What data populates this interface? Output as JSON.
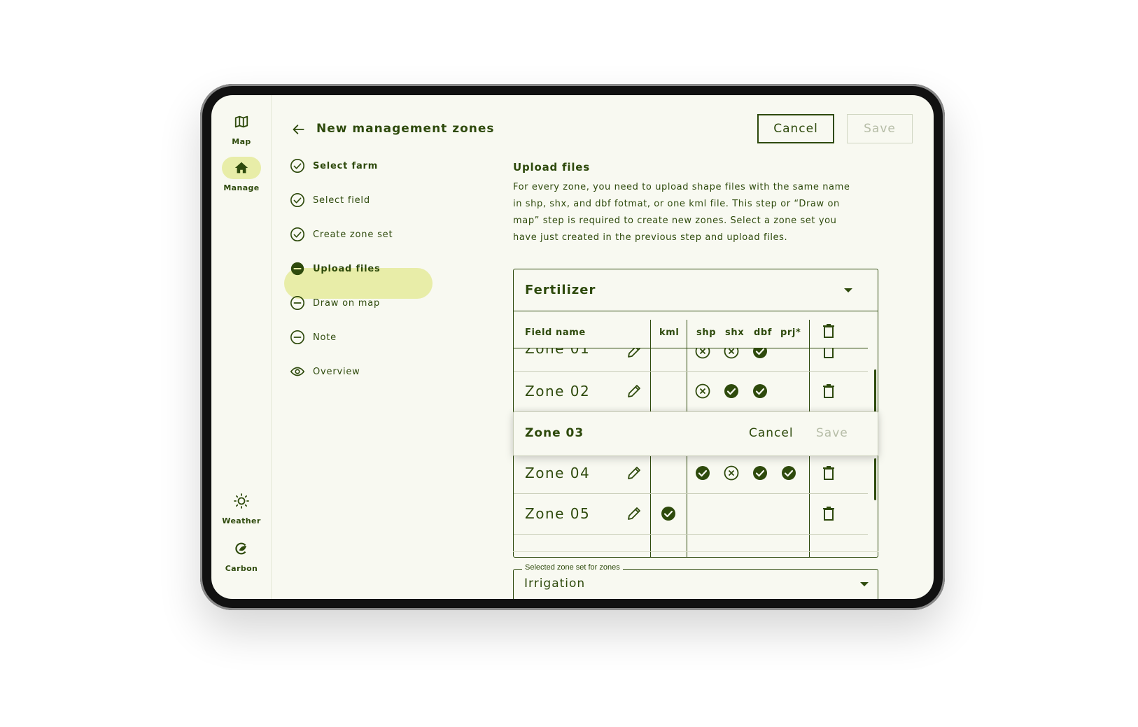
{
  "rail": {
    "items": [
      {
        "label": "Map",
        "icon": "map-icon"
      },
      {
        "label": "Manage",
        "icon": "home-icon",
        "active": true
      },
      {
        "label": "Weather",
        "icon": "sun-icon"
      },
      {
        "label": "Carbon",
        "icon": "carbon-icon"
      }
    ]
  },
  "header": {
    "title": "New management zones",
    "cancel_label": "Cancel",
    "save_label": "Save"
  },
  "steps": [
    {
      "label": "Select farm",
      "status": "done"
    },
    {
      "label": "Select field",
      "status": "done"
    },
    {
      "label": "Create zone set",
      "status": "done"
    },
    {
      "label": "Upload files",
      "status": "current"
    },
    {
      "label": "Draw on map",
      "status": "todo"
    },
    {
      "label": "Note",
      "status": "todo"
    },
    {
      "label": "Overview",
      "status": "view"
    }
  ],
  "upload": {
    "title": "Upload files",
    "description": "For every zone, you need to upload shape files with the same name in shp, shx, and dbf fotmat, or one kml file. This step or “Draw on map” step is required to create  new zones. Select a zone set you have just created in the previous step and upload files."
  },
  "zone_table": {
    "title": "Fertilizer",
    "columns": [
      "Field name",
      "kml",
      "shp",
      "shx",
      "dbf",
      "prj*"
    ],
    "rows": [
      {
        "name": "Zone 01",
        "kml": null,
        "shp": "missing",
        "shx": "missing",
        "dbf": "ok",
        "prj": null
      },
      {
        "name": "Zone 02",
        "kml": null,
        "shp": "missing",
        "shx": "ok",
        "dbf": "ok",
        "prj": null
      },
      {
        "name": "Zone 04",
        "kml": null,
        "shp": "ok",
        "shx": "missing",
        "dbf": "ok",
        "prj": "ok"
      },
      {
        "name": "Zone 05",
        "kml": "ok",
        "shp": null,
        "shx": null,
        "dbf": null,
        "prj": null
      }
    ],
    "editing_row": {
      "name": "Zone 03",
      "cancel_label": "Cancel",
      "save_label": "Save"
    }
  },
  "zone_set_select": {
    "label": "Selected zone set for zones",
    "value": "Irrigation"
  },
  "colors": {
    "primary": "#2e4a0c",
    "accent": "#e8eda8",
    "background": "#f8f9f1",
    "disabled": "#b6bda7"
  }
}
